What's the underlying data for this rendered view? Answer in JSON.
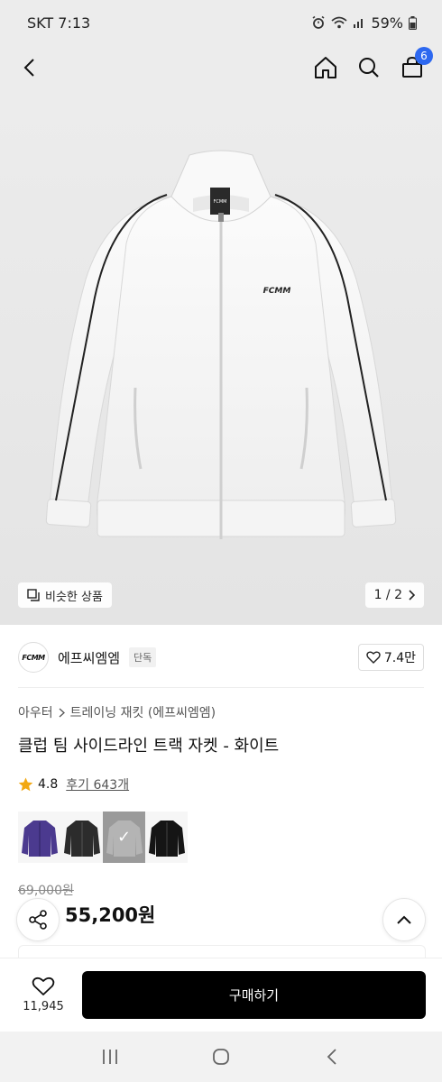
{
  "status_bar": {
    "carrier": "SKT",
    "time": "7:13",
    "battery": "59%"
  },
  "header": {
    "cart_count": "6",
    "icons": [
      "back-icon",
      "home-icon",
      "search-icon",
      "cart-icon"
    ]
  },
  "image": {
    "similar_label": "비슷한 상품",
    "counter": "1 / 2",
    "jacket_logo": "FCMM"
  },
  "brand": {
    "logo_text": "FCMM",
    "name": "에프씨엠엠",
    "tag": "단독",
    "likes": "7.4만"
  },
  "breadcrumb": {
    "category": "아우터",
    "subcategory": "트레이닝 재킷 (에프씨엠엠)"
  },
  "product": {
    "title": "클럽 팀 사이드라인 트랙 자켓 - 화이트",
    "rating": "4.8",
    "reviews": "후기 643개",
    "original_price": "69,000원",
    "sale_price": "55,200원"
  },
  "colors": [
    {
      "name": "purple",
      "hex": "#4b3a8f"
    },
    {
      "name": "charcoal",
      "hex": "#2c2c2c"
    },
    {
      "name": "gray",
      "hex": "#9a9a9a",
      "selected": true
    },
    {
      "name": "black",
      "hex": "#151515"
    }
  ],
  "bottom_bar": {
    "wishlist_count": "11,945",
    "buy_label": "구매하기"
  },
  "accent": {
    "badge": "#2d68f0",
    "star": "#f2a812"
  }
}
